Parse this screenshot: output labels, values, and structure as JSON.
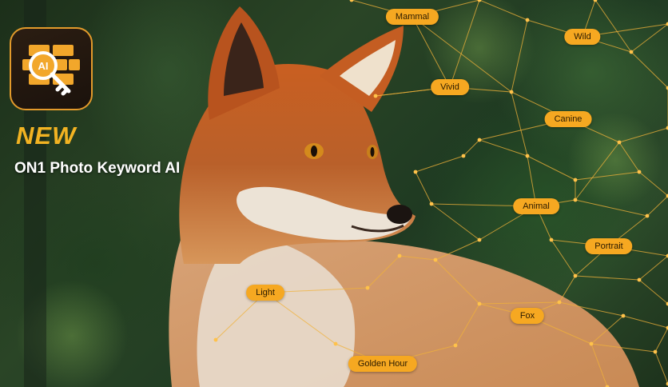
{
  "brand": {
    "badge_text": "NEW",
    "product_name": "ON1 Photo Keyword AI",
    "logo_text": "AI"
  },
  "keywords": [
    {
      "label": "Mammal"
    },
    {
      "label": "Wild"
    },
    {
      "label": "Vivid"
    },
    {
      "label": "Canine"
    },
    {
      "label": "Animal"
    },
    {
      "label": "Portrait"
    },
    {
      "label": "Light"
    },
    {
      "label": "Fox"
    },
    {
      "label": "Golden Hour"
    }
  ],
  "colors": {
    "accent": "#f6a821",
    "badge": "#f2b322",
    "background": "#24391f",
    "fox_fur": "#c8642a"
  },
  "icons": [
    "key-icon",
    "network-graph",
    "fox-photo"
  ]
}
